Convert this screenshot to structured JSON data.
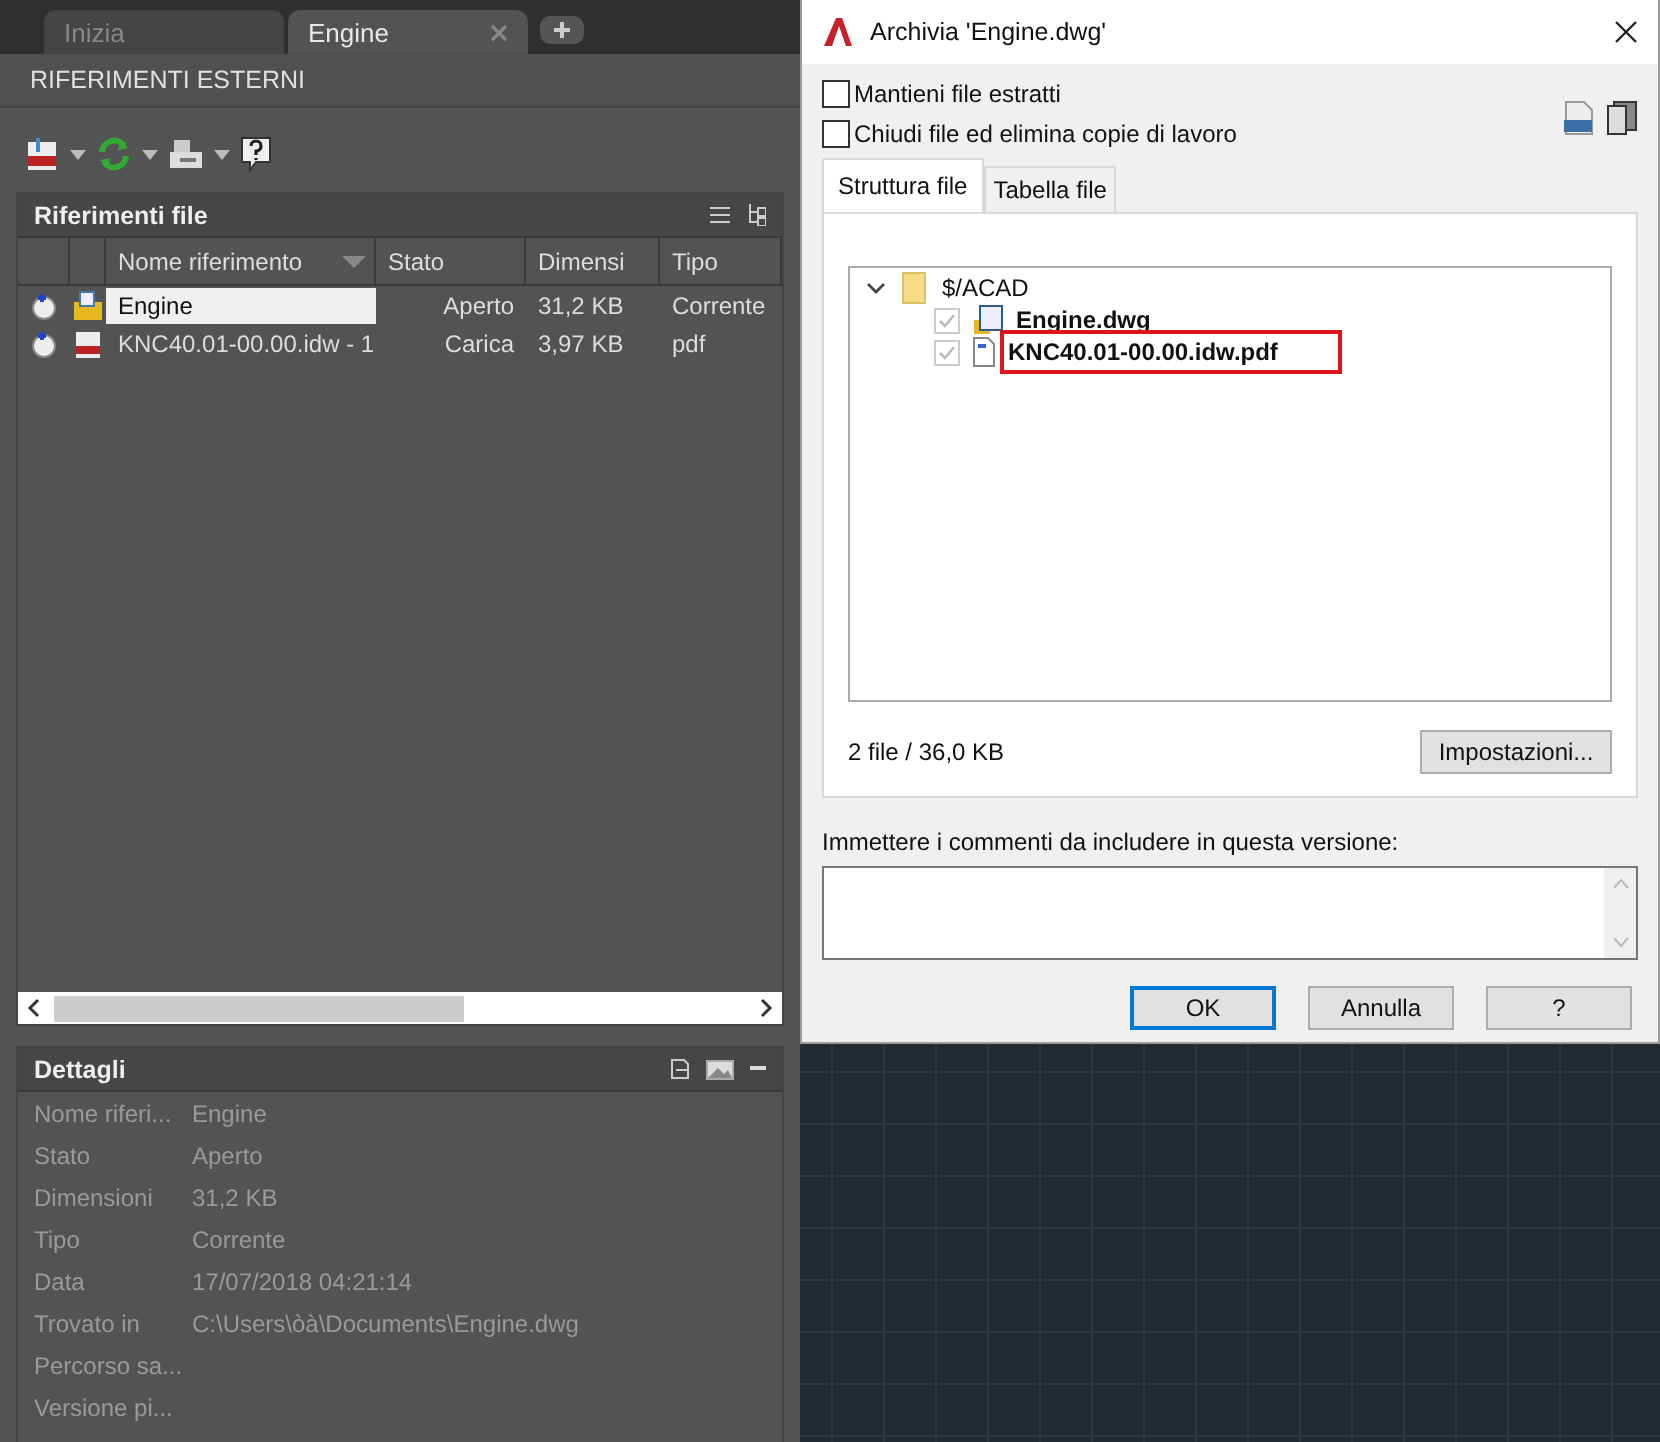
{
  "tabs": [
    {
      "label": "Inizia",
      "selected": false,
      "closable": false
    },
    {
      "label": "Engine",
      "selected": true,
      "closable": true
    }
  ],
  "palette_title": "RIFERIMENTI ESTERNI",
  "file_refs": {
    "title": "Riferimenti file",
    "columns": [
      "Nome riferimento",
      "Stato",
      "Dimensi",
      "Tipo"
    ],
    "rows": [
      {
        "kind": "dwg",
        "name": "Engine",
        "status": "Aperto",
        "size": "31,2 KB",
        "type": "Corrente",
        "selected": true
      },
      {
        "kind": "pdf",
        "name": "KNC40.01-00.00.idw - 1",
        "status": "Carica",
        "size": "3,97 KB",
        "type": "pdf",
        "selected": false
      }
    ]
  },
  "details": {
    "title": "Dettagli",
    "rows": [
      {
        "label": "Nome riferi...",
        "value": "Engine"
      },
      {
        "label": "Stato",
        "value": "Aperto"
      },
      {
        "label": "Dimensioni",
        "value": "31,2 KB"
      },
      {
        "label": "Tipo",
        "value": "Corrente"
      },
      {
        "label": "Data",
        "value": "17/07/2018 04:21:14"
      },
      {
        "label": "Trovato in",
        "value": "C:\\Users\\òà\\Documents\\Engine.dwg"
      },
      {
        "label": "Percorso sa..."
      },
      {
        "label": "Versione pi..."
      }
    ]
  },
  "dialog": {
    "title": "Archivia 'Engine.dwg'",
    "options": [
      {
        "label": "Mantieni file estratti",
        "checked": false
      },
      {
        "label": "Chiudi file ed elimina copie di lavoro",
        "checked": false
      }
    ],
    "tabs": [
      {
        "label": "Struttura file",
        "selected": true
      },
      {
        "label": "Tabella file",
        "selected": false
      }
    ],
    "tree": [
      {
        "kind": "folder",
        "label": "$/ACAD",
        "expanded": true,
        "children": [
          {
            "kind": "dwg",
            "label": "Engine.dwg",
            "checked": true,
            "highlighted": false
          },
          {
            "kind": "pdf",
            "label": "KNC40.01-00.00.idw.pdf",
            "checked": true,
            "highlighted": true
          }
        ]
      }
    ],
    "summary": "2 file / 36,0 KB",
    "settings_button": "Impostazioni...",
    "comment_label": "Immettere i commenti da includere in questa versione:",
    "buttons": [
      {
        "label": "OK",
        "default": true
      },
      {
        "label": "Annulla",
        "default": false
      },
      {
        "label": "?",
        "default": false
      }
    ]
  }
}
